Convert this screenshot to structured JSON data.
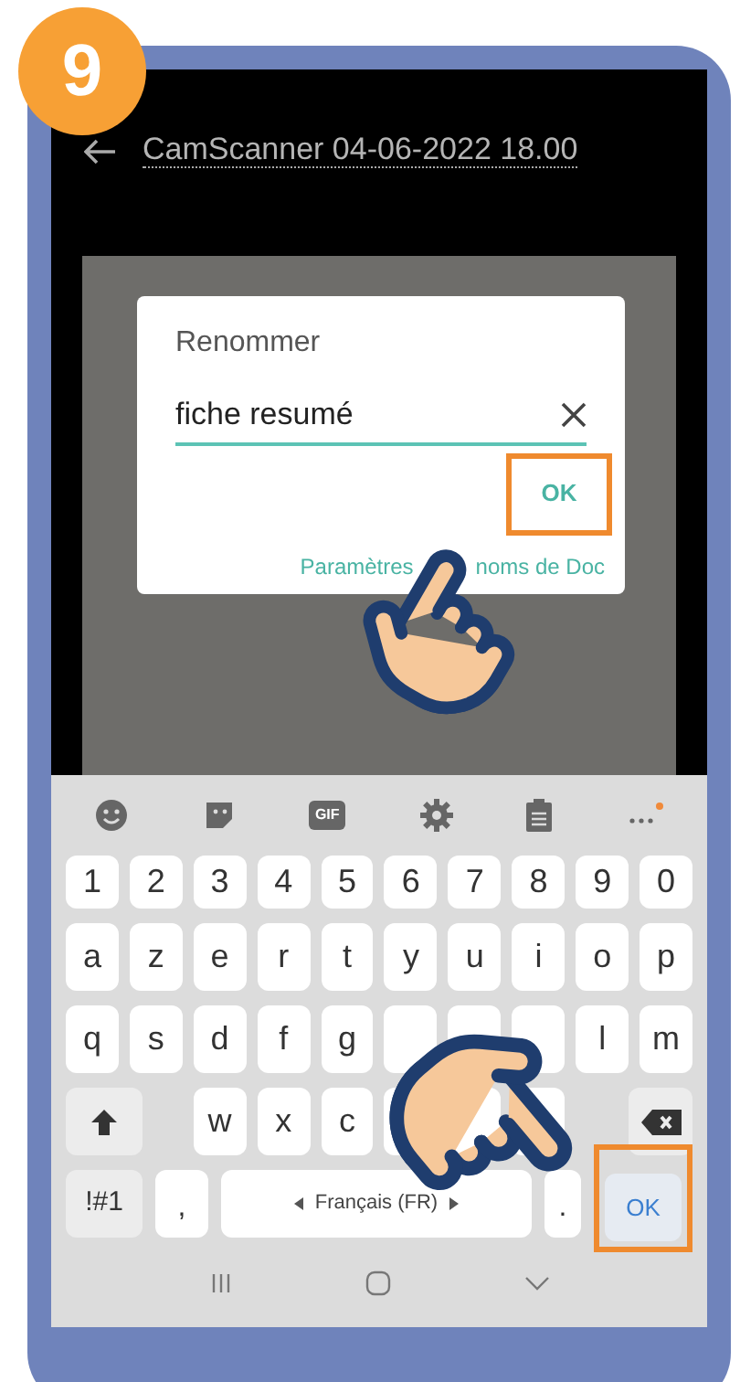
{
  "step_badge": "9",
  "header": {
    "title": "CamScanner 04-06-2022 18.00"
  },
  "dialog": {
    "title": "Renommer",
    "field": {
      "value": "fiche resumé"
    },
    "ok_button": {
      "label": "OK",
      "highlighted": true
    },
    "link_parts": [
      "Paramètres",
      "noms de Doc"
    ]
  },
  "keyboard": {
    "toolbar": {
      "gif_label": "GIF",
      "notification": true
    },
    "rows": [
      [
        {
          "kind": "char",
          "label": "1"
        },
        {
          "kind": "char",
          "label": "2"
        },
        {
          "kind": "char",
          "label": "3"
        },
        {
          "kind": "char",
          "label": "4"
        },
        {
          "kind": "char",
          "label": "5"
        },
        {
          "kind": "char",
          "label": "6"
        },
        {
          "kind": "char",
          "label": "7"
        },
        {
          "kind": "char",
          "label": "8"
        },
        {
          "kind": "char",
          "label": "9"
        },
        {
          "kind": "char",
          "label": "0"
        }
      ],
      [
        {
          "kind": "char",
          "label": "a"
        },
        {
          "kind": "char",
          "label": "z"
        },
        {
          "kind": "char",
          "label": "e"
        },
        {
          "kind": "char",
          "label": "r"
        },
        {
          "kind": "char",
          "label": "t"
        },
        {
          "kind": "char",
          "label": "y"
        },
        {
          "kind": "char",
          "label": "u"
        },
        {
          "kind": "char",
          "label": "i"
        },
        {
          "kind": "char",
          "label": "o"
        },
        {
          "kind": "char",
          "label": "p"
        }
      ],
      [
        {
          "kind": "char",
          "label": "q"
        },
        {
          "kind": "char",
          "label": "s"
        },
        {
          "kind": "char",
          "label": "d"
        },
        {
          "kind": "char",
          "label": "f"
        },
        {
          "kind": "char",
          "label": "g"
        },
        {
          "kind": "covered"
        },
        {
          "kind": "covered"
        },
        {
          "kind": "covered"
        },
        {
          "kind": "char",
          "label": "l"
        },
        {
          "kind": "char",
          "label": "m"
        }
      ],
      [
        {
          "kind": "shift"
        },
        {
          "kind": "gap"
        },
        {
          "kind": "char",
          "label": "w"
        },
        {
          "kind": "char",
          "label": "x"
        },
        {
          "kind": "char",
          "label": "c"
        },
        {
          "kind": "covered"
        },
        {
          "kind": "covered"
        },
        {
          "kind": "covered"
        },
        {
          "kind": "gap"
        },
        {
          "kind": "backspace"
        }
      ]
    ],
    "bottom_row": {
      "symbols": "!#1",
      "comma": ",",
      "language": "Français (FR)",
      "period": ".",
      "ok": {
        "label": "OK",
        "highlighted": true
      }
    }
  }
}
